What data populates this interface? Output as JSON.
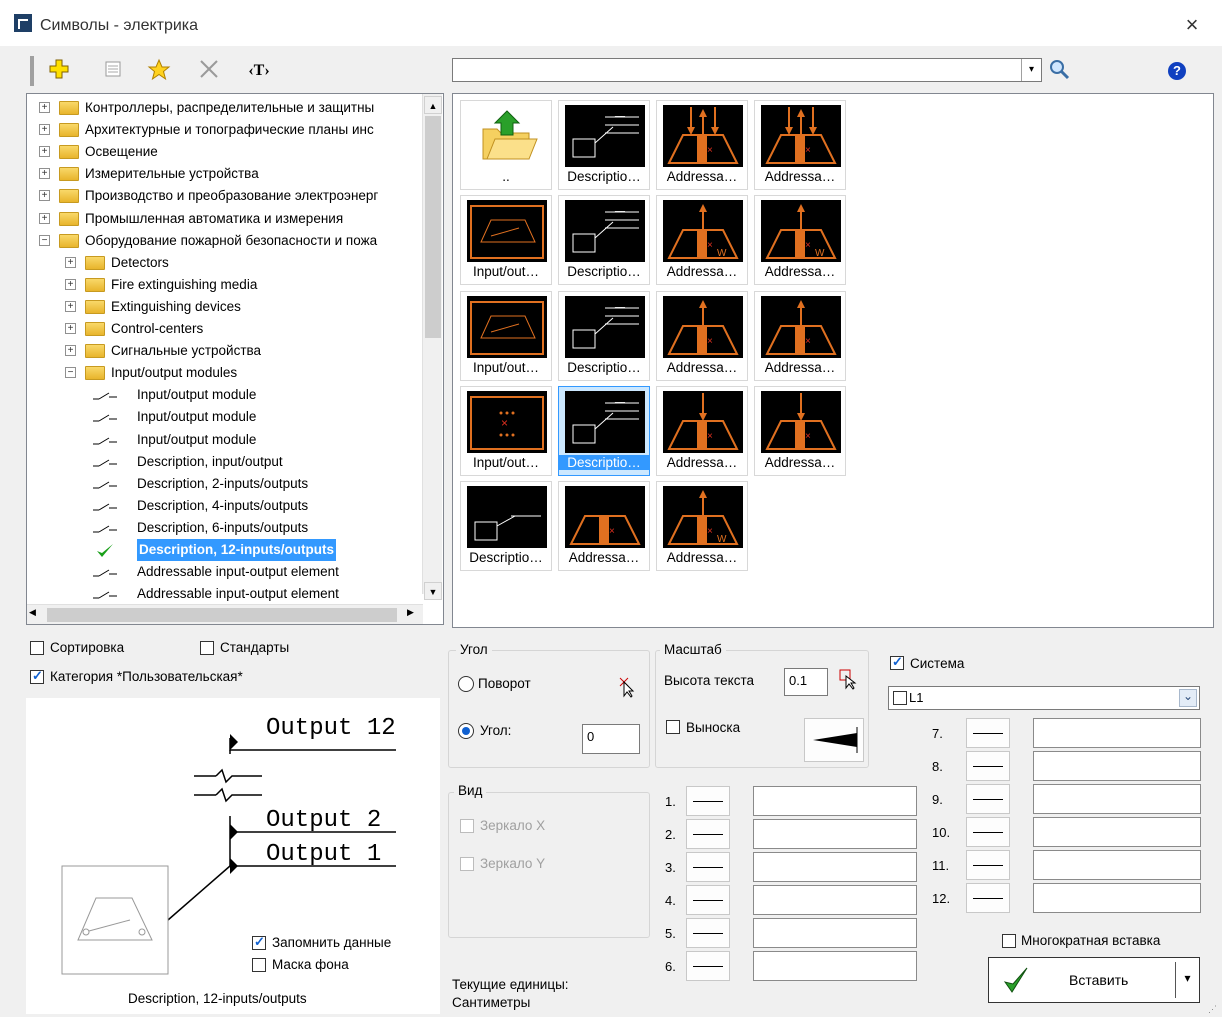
{
  "window": {
    "title": "Символы - электрика",
    "close": "×"
  },
  "toolbar": {
    "buttons": [
      "add-icon",
      "properties-icon",
      "favorites-icon",
      "delete-icon",
      "text-icon"
    ],
    "text_glyph": "‹T›",
    "help": "?"
  },
  "search": {
    "value": "",
    "arrow": "▾"
  },
  "tree": {
    "items": [
      {
        "label": "Контроллеры, распределительные и защитны",
        "level": 0,
        "type": "folder",
        "exp": "+"
      },
      {
        "label": "Архитектурные и топографические планы инс",
        "level": 0,
        "type": "folder",
        "exp": "+"
      },
      {
        "label": "Освещение",
        "level": 0,
        "type": "folder",
        "exp": "+"
      },
      {
        "label": "Измерительные устройства",
        "level": 0,
        "type": "folder",
        "exp": "+"
      },
      {
        "label": "Производство и преобразование электроэнерг",
        "level": 0,
        "type": "folder",
        "exp": "+"
      },
      {
        "label": "Промышленная автоматика и измерения",
        "level": 0,
        "type": "folder",
        "exp": "+"
      },
      {
        "label": "Оборудование пожарной безопасности и пожа",
        "level": 0,
        "type": "folder",
        "exp": "−"
      },
      {
        "label": "Detectors",
        "level": 1,
        "type": "folder",
        "exp": "+"
      },
      {
        "label": "Fire extinguishing media",
        "level": 1,
        "type": "folder",
        "exp": "+"
      },
      {
        "label": "Extinguishing devices",
        "level": 1,
        "type": "folder",
        "exp": "+"
      },
      {
        "label": "Control-centers",
        "level": 1,
        "type": "folder",
        "exp": "+"
      },
      {
        "label": "Сигнальные устройства",
        "level": 1,
        "type": "folder",
        "exp": "+"
      },
      {
        "label": "Input/output modules",
        "level": 1,
        "type": "folder",
        "exp": "−"
      },
      {
        "label": "Input/output module",
        "level": 2,
        "type": "leaf"
      },
      {
        "label": "Input/output module",
        "level": 2,
        "type": "leaf"
      },
      {
        "label": "Input/output module",
        "level": 2,
        "type": "leaf"
      },
      {
        "label": "Description, input/output",
        "level": 2,
        "type": "leaf"
      },
      {
        "label": "Description, 2-inputs/outputs",
        "level": 2,
        "type": "leaf"
      },
      {
        "label": "Description, 4-inputs/outputs",
        "level": 2,
        "type": "leaf"
      },
      {
        "label": "Description, 6-inputs/outputs",
        "level": 2,
        "type": "leaf"
      },
      {
        "label": "Description, 12-inputs/outputs",
        "level": 2,
        "type": "leaf",
        "selected": true
      },
      {
        "label": "Addressable input-output element",
        "level": 2,
        "type": "leaf"
      },
      {
        "label": "Addressable input-output element",
        "level": 2,
        "type": "leaf"
      }
    ]
  },
  "grid": {
    "cells": [
      {
        "label": "..",
        "kind": "up"
      },
      {
        "label": "Descriptio…",
        "kind": "desc"
      },
      {
        "label": "Addressa…",
        "kind": "addr-in"
      },
      {
        "label": "Addressa…",
        "kind": "addr-in"
      },
      {
        "label": "Input/out…",
        "kind": "io"
      },
      {
        "label": "Descriptio…",
        "kind": "desc"
      },
      {
        "label": "Addressa…",
        "kind": "addr-w"
      },
      {
        "label": "Addressa…",
        "kind": "addr-w"
      },
      {
        "label": "Input/out…",
        "kind": "io"
      },
      {
        "label": "Descriptio…",
        "kind": "desc"
      },
      {
        "label": "Addressa…",
        "kind": "addr-up"
      },
      {
        "label": "Addressa…",
        "kind": "addr-up"
      },
      {
        "label": "Input/out…",
        "kind": "io2"
      },
      {
        "label": "Descriptio…",
        "kind": "desc",
        "selected": true
      },
      {
        "label": "Addressa…",
        "kind": "addr-down"
      },
      {
        "label": "Addressa…",
        "kind": "addr-down"
      },
      {
        "label": "Descriptio…",
        "kind": "desc1"
      },
      {
        "label": "Addressa…",
        "kind": "addr"
      },
      {
        "label": "Addressa…",
        "kind": "addr-w"
      }
    ]
  },
  "options": {
    "sort": "Сортировка",
    "standards": "Стандарты",
    "category": "Категория *Пользовательская*",
    "remember": "Запомнить данные",
    "mask": "Маска фона",
    "preview_caption": "Description, 12-inputs/outputs"
  },
  "preview": {
    "out12": "Output 12",
    "out2": "Output 2",
    "out1": "Output 1"
  },
  "angle": {
    "title": "Угол",
    "rotate": "Поворот",
    "angle_label": "Угол:",
    "angle_value": "0"
  },
  "view": {
    "title": "Вид",
    "mirror_x": "Зеркало X",
    "mirror_y": "Зеркало Y"
  },
  "scale": {
    "title": "Масштаб",
    "text_height_label": "Высота текста",
    "text_height": "0.1",
    "callout": "Выноска"
  },
  "units": {
    "line1": "Текущие единицы:",
    "line2": "Сантиметры"
  },
  "system": {
    "label": "Система",
    "value": "L1",
    "arrow": "⌄"
  },
  "rows_left": [
    "1.",
    "2.",
    "3.",
    "4.",
    "5.",
    "6."
  ],
  "rows_right": [
    "7.",
    "8.",
    "9.",
    "10.",
    "11.",
    "12."
  ],
  "multi_insert": "Многократная вставка",
  "insert": {
    "label": "Вставить",
    "arrow": "▾"
  },
  "colors": {
    "accent": "#3399ff",
    "symbol_orange": "#e07020",
    "symbol_bg": "#000000"
  }
}
